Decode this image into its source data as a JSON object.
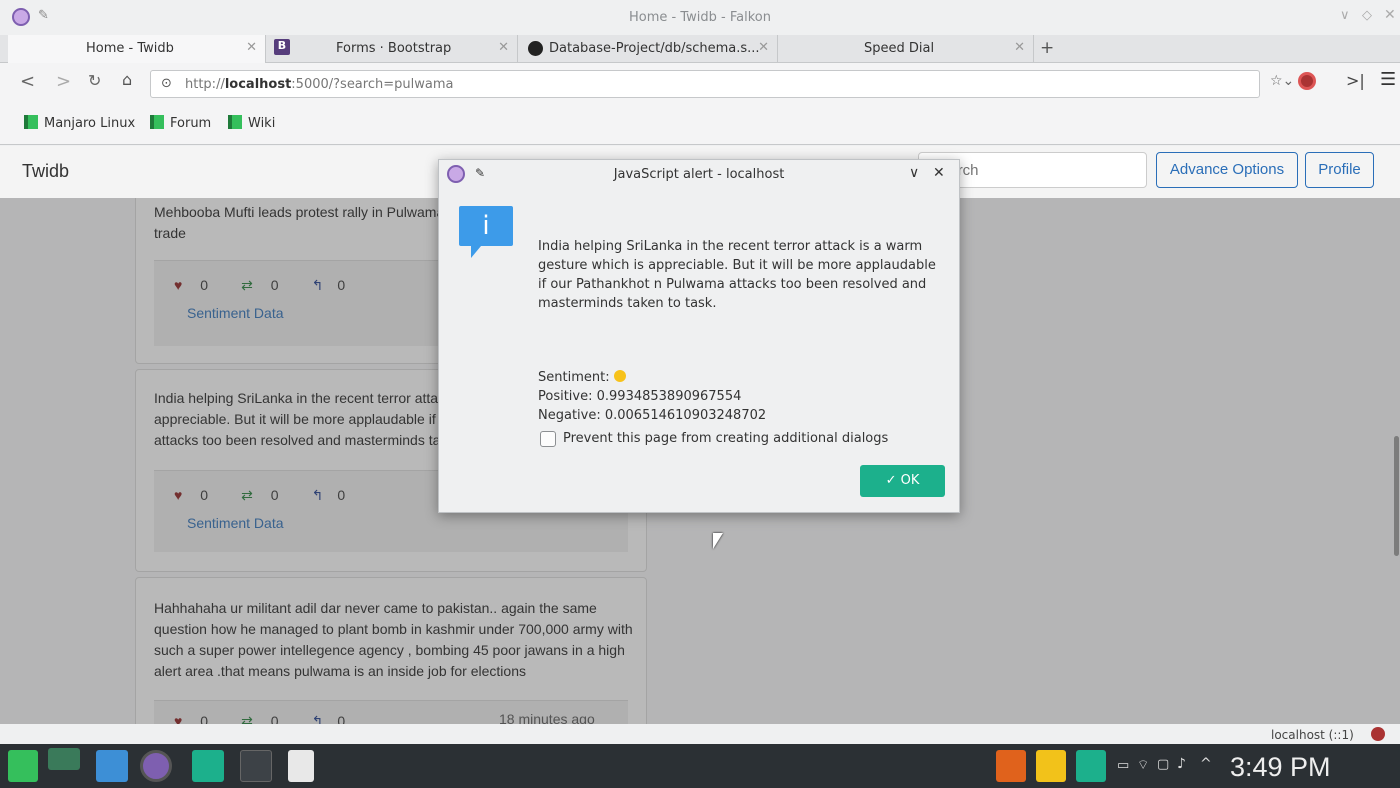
{
  "window": {
    "title": "Home - Twidb - Falkon"
  },
  "tabs": [
    {
      "label": "Home - Twidb"
    },
    {
      "label": "Forms · Bootstrap"
    },
    {
      "label": "Database-Project/db/schema.s..."
    },
    {
      "label": "Speed Dial"
    }
  ],
  "nav": {
    "url_prefix": "http://",
    "url_host": "localhost",
    "url_rest": ":5000/?search=pulwama"
  },
  "bookmarks": [
    {
      "label": "Manjaro Linux"
    },
    {
      "label": "Forum"
    },
    {
      "label": "Wiki"
    }
  ],
  "app": {
    "brand": "Twidb",
    "search_placeholder": "Search",
    "advance_options": "Advance Options",
    "profile": "Profile"
  },
  "tweets": [
    {
      "text": "Mehbooba Mufti leads protest rally in Pulwama against suspension of LoC trade",
      "likes": "0",
      "retweets": "0",
      "replies": "0",
      "sentiment_link": "Sentiment Data"
    },
    {
      "text": "India helping SriLanka in the recent terror attack is a warm gesture which is appreciable. But it will be more applaudable if our Pathankhot n Pulwama attacks too been resolved and masterminds taken to task.",
      "likes": "0",
      "retweets": "0",
      "replies": "0",
      "sentiment_link": "Sentiment Data"
    },
    {
      "text": "Hahhahaha ur militant adil dar never came to pakistan.. again the same question how he managed to plant bomb in kashmir under 700,000 army with such a super power intellegence agency , bombing 45 poor jawans in a high alert area .that means pulwama is an inside job for elections",
      "likes": "0",
      "retweets": "0",
      "replies": "0",
      "time": "18 minutes ago"
    }
  ],
  "dialog": {
    "title": "JavaScript alert - localhost",
    "message": "India helping SriLanka in the recent terror attack is a warm gesture which is appreciable. But it will be more applaudable if our Pathankhot n Pulwama attacks too been resolved and masterminds taken to task.",
    "sentiment_label": "Sentiment:",
    "positive": "Positive: 0.9934853890967554",
    "negative": "Negative: 0.006514610903248702",
    "checkbox_label": "Prevent this page from creating additional dialogs",
    "ok_label": "OK"
  },
  "statusbar": {
    "text": "localhost (::1)"
  },
  "taskbar": {
    "clock": "3:49 PM"
  },
  "colors": {
    "accent": "#1cb08c",
    "link": "#2a6eb8",
    "heart": "#c0392b",
    "retweet": "#1e7e34",
    "reply": "#1a3a8c",
    "info": "#3d9be9"
  }
}
